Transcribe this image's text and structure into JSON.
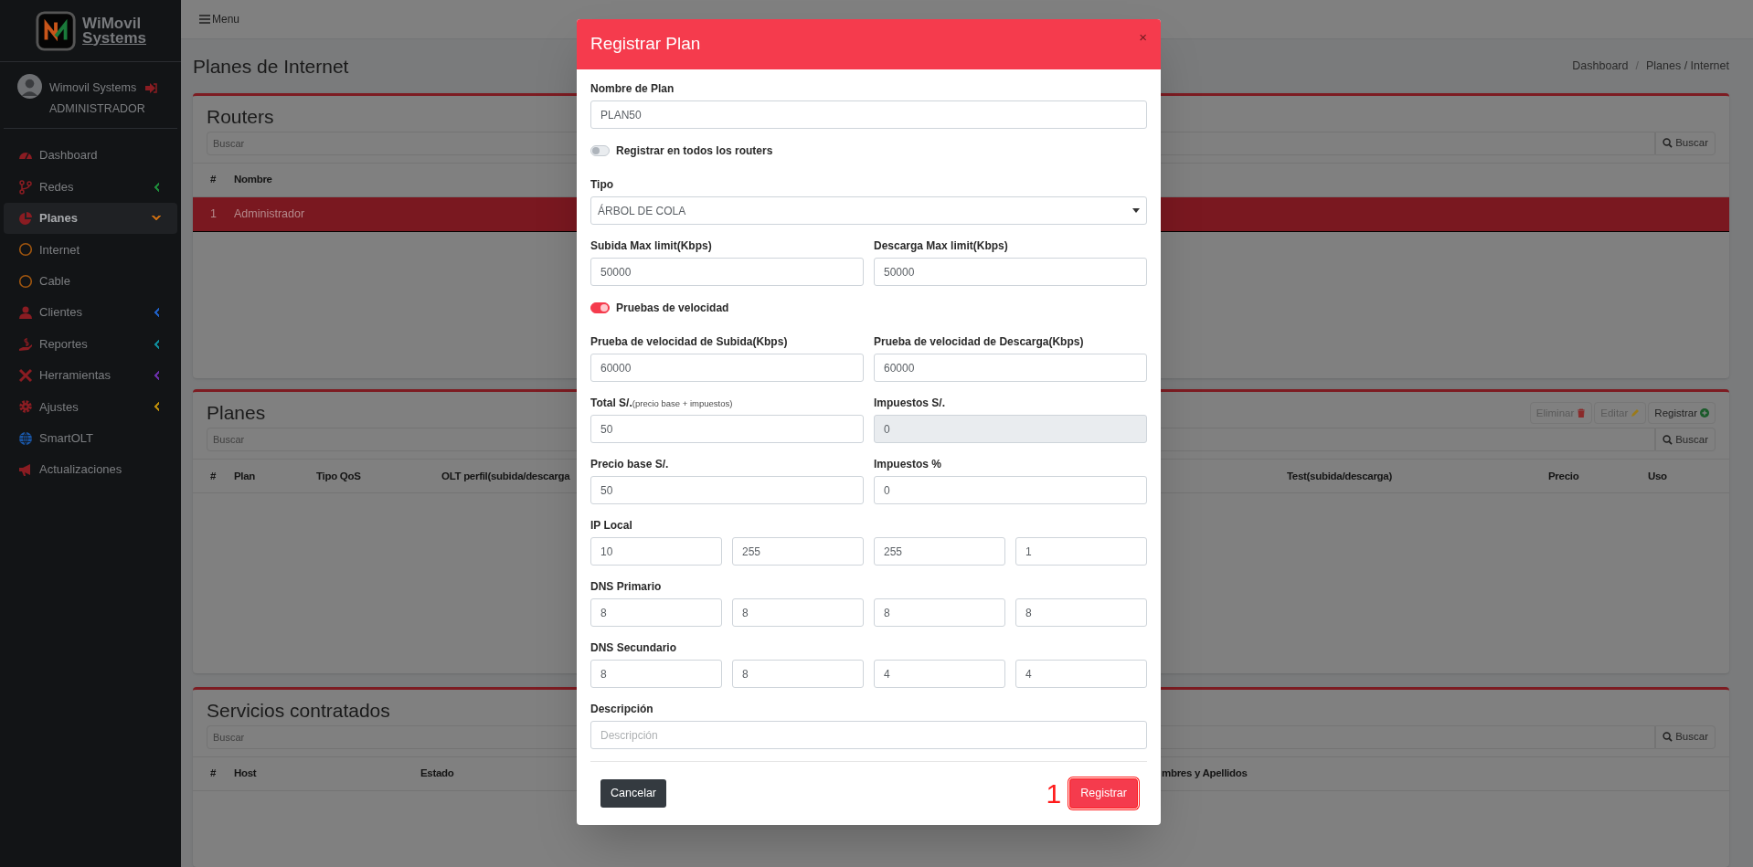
{
  "sidebar": {
    "brand": [
      "WiMovil",
      "Systems"
    ],
    "user": {
      "name": "Wimovil Systems",
      "role": "ADMINISTRADOR"
    },
    "items": [
      {
        "label": "Dashboard",
        "kind": "link",
        "selected": false
      },
      {
        "label": "Redes",
        "kind": "group",
        "selected": false,
        "expanded": false,
        "color": "#1e8a3a"
      },
      {
        "label": "Planes",
        "kind": "group",
        "selected": true,
        "expanded": true,
        "color": "#c46a12",
        "children": [
          {
            "label": "Internet",
            "selected": false
          },
          {
            "label": "Cable",
            "selected": false
          }
        ]
      },
      {
        "label": "Clientes",
        "kind": "group",
        "selected": false,
        "expanded": false,
        "color": "#1f5fc4"
      },
      {
        "label": "Reportes",
        "kind": "group",
        "selected": false,
        "expanded": false,
        "color": "#0f8a99"
      },
      {
        "label": "Herramientas",
        "kind": "group",
        "selected": false,
        "expanded": false,
        "color": "#6a2fa8"
      },
      {
        "label": "Ajustes",
        "kind": "group",
        "selected": false,
        "expanded": false,
        "color": "#b88a0a"
      },
      {
        "label": "SmartOLT",
        "kind": "link",
        "selected": false
      },
      {
        "label": "Actualizaciones",
        "kind": "link",
        "selected": false
      }
    ]
  },
  "topbar": {
    "menu_label": "Menu"
  },
  "page_title": "Planes de Internet",
  "breadcrumb": {
    "items": [
      "Dashboard",
      "Planes / Internet"
    ],
    "separator": "/"
  },
  "cards": [
    {
      "title": "Routers",
      "search": {
        "placeholder": "Buscar",
        "button": "Buscar"
      },
      "columns": [
        "#",
        "Nombre"
      ],
      "rows": [
        {
          "cells": [
            "1",
            "Administrador"
          ],
          "selected": true
        }
      ]
    },
    {
      "title": "Planes",
      "actions": [
        {
          "label": "Eliminar",
          "disabled": true
        },
        {
          "label": "Editar",
          "disabled": true
        },
        {
          "label": "Registrar",
          "disabled": false
        }
      ],
      "search": {
        "placeholder": "Buscar",
        "button": "Buscar"
      },
      "columns": [
        "#",
        "Plan",
        "Tipo QoS",
        "OLT perfil(subida/descarga",
        "Test(subida/descarga)",
        "Precio",
        "Uso"
      ]
    },
    {
      "title": "Servicios contratados",
      "search": {
        "placeholder": "Buscar",
        "button": "Buscar"
      },
      "columns": [
        "#",
        "Host",
        "Estado",
        "mbres y Apellidos"
      ]
    }
  ],
  "modal": {
    "title": "Registrar Plan",
    "close": "×",
    "fields": [
      {
        "kind": "text",
        "label": "Nombre de Plan",
        "value": "PLAN50"
      },
      {
        "kind": "toggle",
        "label": "Registrar en todos los routers",
        "on": false
      },
      {
        "kind": "select",
        "label": "Tipo",
        "value": "ÁRBOL DE COLA"
      },
      {
        "kind": "row",
        "items": [
          {
            "label": "Subida Max limit(Kbps)",
            "value": "50000",
            "disabled": false
          },
          {
            "label": "Descarga Max limit(Kbps)",
            "value": "50000",
            "disabled": false
          }
        ]
      },
      {
        "kind": "toggle",
        "label": "Pruebas de velocidad",
        "on": true
      },
      {
        "kind": "row",
        "items": [
          {
            "label": "Prueba de velocidad de Subida(Kbps)",
            "value": "60000",
            "disabled": false
          },
          {
            "label": "Prueba de velocidad de Descarga(Kbps)",
            "value": "60000",
            "disabled": false
          }
        ]
      },
      {
        "kind": "row",
        "items": [
          {
            "label": "Total S/.",
            "note": "(precio base + impuestos)",
            "value": "50",
            "disabled": false
          },
          {
            "label": "Impuestos S/.",
            "value": "0",
            "disabled": true
          }
        ]
      },
      {
        "kind": "row",
        "items": [
          {
            "label": "Precio base S/.",
            "value": "50",
            "disabled": false
          },
          {
            "label": "Impuestos %",
            "value": "0",
            "disabled": false
          }
        ]
      },
      {
        "kind": "octets",
        "label": "IP Local",
        "values": [
          "10",
          "255",
          "255",
          "1"
        ]
      },
      {
        "kind": "octets",
        "label": "DNS Primario",
        "values": [
          "8",
          "8",
          "8",
          "8"
        ]
      },
      {
        "kind": "octets",
        "label": "DNS Secundario",
        "values": [
          "8",
          "8",
          "4",
          "4"
        ]
      },
      {
        "kind": "text",
        "label": "Descripción",
        "placeholder": "Descripción"
      }
    ],
    "buttons": [
      {
        "label": "Cancelar",
        "kind": "secondary"
      },
      {
        "label": "Registrar",
        "kind": "primary",
        "highlighted": true
      }
    ],
    "annotation": "1"
  }
}
